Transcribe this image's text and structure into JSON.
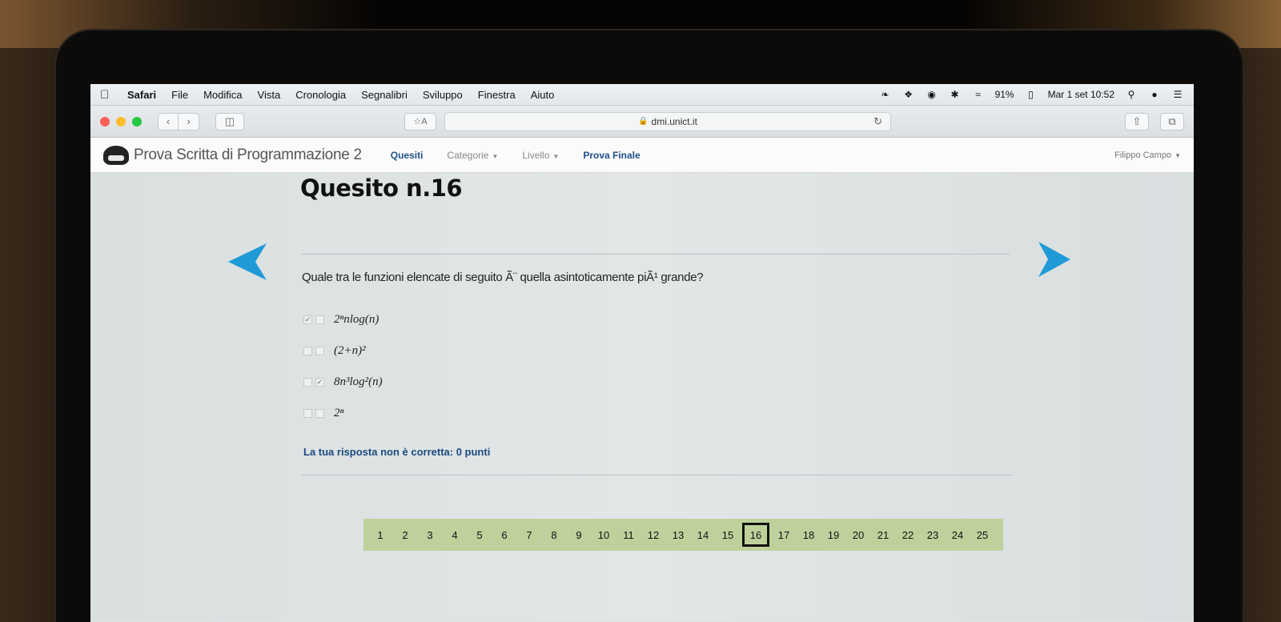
{
  "menubar": {
    "app": "Safari",
    "items": [
      "File",
      "Modifica",
      "Vista",
      "Cronologia",
      "Segnalibri",
      "Sviluppo",
      "Finestra",
      "Aiuto"
    ],
    "battery": "91%",
    "datetime": "Mar 1 set 10:52"
  },
  "toolbar": {
    "reader_label": "A",
    "url": "dmi.unict.it"
  },
  "sitenav": {
    "brand": "Prova Scritta di Programmazione 2",
    "links": [
      {
        "label": "Quesiti",
        "active": true,
        "dropdown": false
      },
      {
        "label": "Categorie",
        "active": false,
        "dropdown": true
      },
      {
        "label": "Livello",
        "active": false,
        "dropdown": true
      },
      {
        "label": "Prova Finale",
        "active": true,
        "dropdown": false
      }
    ],
    "user": "Filippo Campo"
  },
  "quiz": {
    "title": "Quesito n.16",
    "question": "Quale tra le funzioni elencate di seguito Ã¨ quella asintoticamente piÃ¹ grande?",
    "options": [
      {
        "label": "2ⁿnlog(n)",
        "marks": [
          "✓",
          ""
        ]
      },
      {
        "label": "(2+n)²",
        "marks": [
          "",
          ""
        ]
      },
      {
        "label": "8n³log²(n)",
        "marks": [
          "",
          "✓"
        ]
      },
      {
        "label": "2ⁿ",
        "marks": [
          "",
          ""
        ]
      }
    ],
    "result": "La tua risposta non è corretta: 0 punti",
    "pages": [
      "1",
      "2",
      "3",
      "4",
      "5",
      "6",
      "7",
      "8",
      "9",
      "10",
      "11",
      "12",
      "13",
      "14",
      "15",
      "16",
      "17",
      "18",
      "19",
      "20",
      "21",
      "22",
      "23",
      "24",
      "25"
    ],
    "current_page": "16"
  },
  "colors": {
    "accent_blue": "#1f9ad6",
    "link_blue": "#1f4f88",
    "pager_green": "#bfd19b"
  }
}
